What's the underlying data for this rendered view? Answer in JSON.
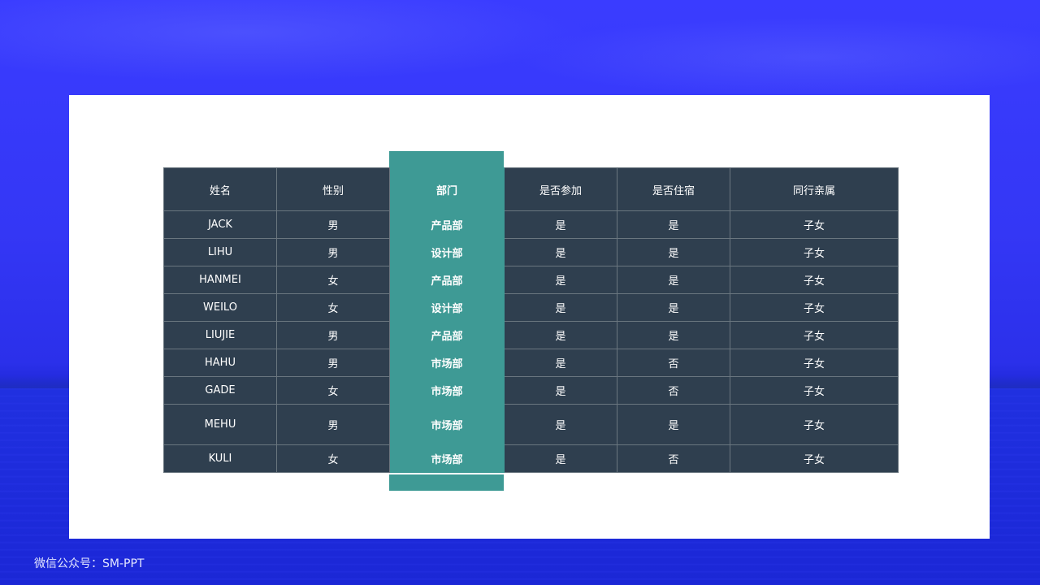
{
  "table": {
    "headers": [
      "姓名",
      "性别",
      "部门",
      "是否参加",
      "是否住宿",
      "同行亲属"
    ],
    "rows": [
      [
        "JACK",
        "男",
        "产品部",
        "是",
        "是",
        "子女"
      ],
      [
        "LIHU",
        "男",
        "设计部",
        "是",
        "是",
        "子女"
      ],
      [
        "HANMEI",
        "女",
        "产品部",
        "是",
        "是",
        "子女"
      ],
      [
        "WEILO",
        "女",
        "设计部",
        "是",
        "是",
        "子女"
      ],
      [
        "LIUJIE",
        "男",
        "产品部",
        "是",
        "是",
        "子女"
      ],
      [
        "HAHU",
        "男",
        "市场部",
        "是",
        "否",
        "子女"
      ],
      [
        "GADE",
        "女",
        "市场部",
        "是",
        "否",
        "子女"
      ],
      [
        "MEHU",
        "男",
        "市场部",
        "是",
        "是",
        "子女"
      ],
      [
        "KULI",
        "女",
        "市场部",
        "是",
        "否",
        "子女"
      ]
    ]
  },
  "footer": {
    "credit": "微信公众号：SM-PPT"
  },
  "colors": {
    "header_bg": "#2f3f4f",
    "highlight_column": "#3e9a95",
    "background_blue": "#3437f5"
  }
}
